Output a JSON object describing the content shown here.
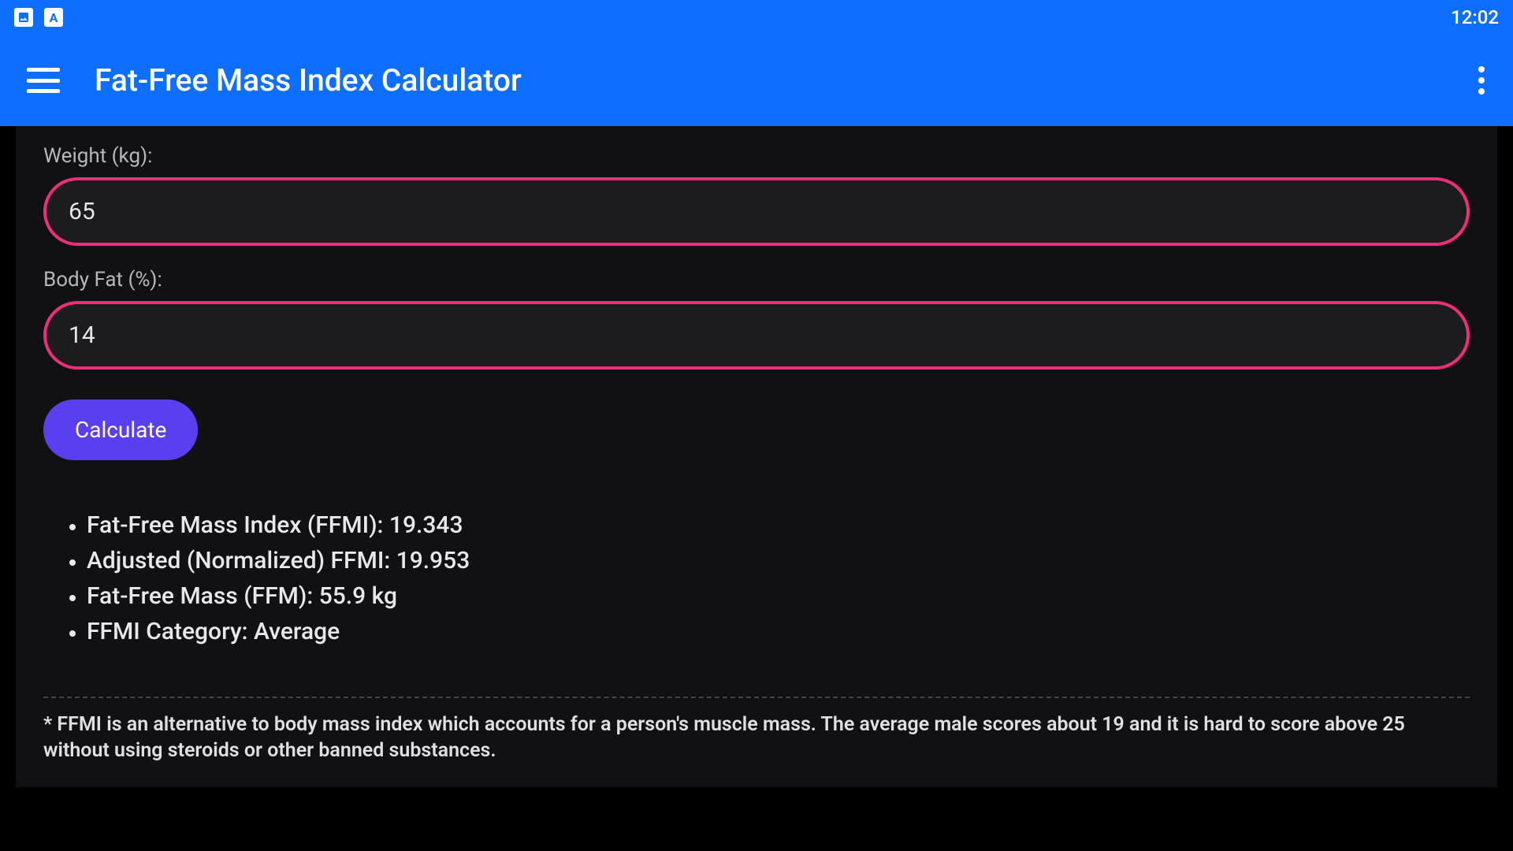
{
  "status": {
    "clock": "12:02",
    "icon1_glyph": "▲",
    "icon2_glyph": "A"
  },
  "header": {
    "title": "Fat-Free Mass Index Calculator"
  },
  "form": {
    "weight_label": "Weight (kg):",
    "weight_value": "65",
    "bodyfat_label": "Body Fat (%):",
    "bodyfat_value": "14",
    "calculate_label": "Calculate"
  },
  "results": {
    "items": [
      "Fat-Free Mass Index (FFMI): 19.343",
      "Adjusted (Normalized) FFMI: 19.953",
      "Fat-Free Mass (FFM): 55.9 kg",
      "FFMI Category: Average"
    ]
  },
  "footnote": "* FFMI is an alternative to body mass index which accounts for a person's muscle mass. The average male scores about 19 and it is hard to score above 25 without using steroids or other banned substances."
}
